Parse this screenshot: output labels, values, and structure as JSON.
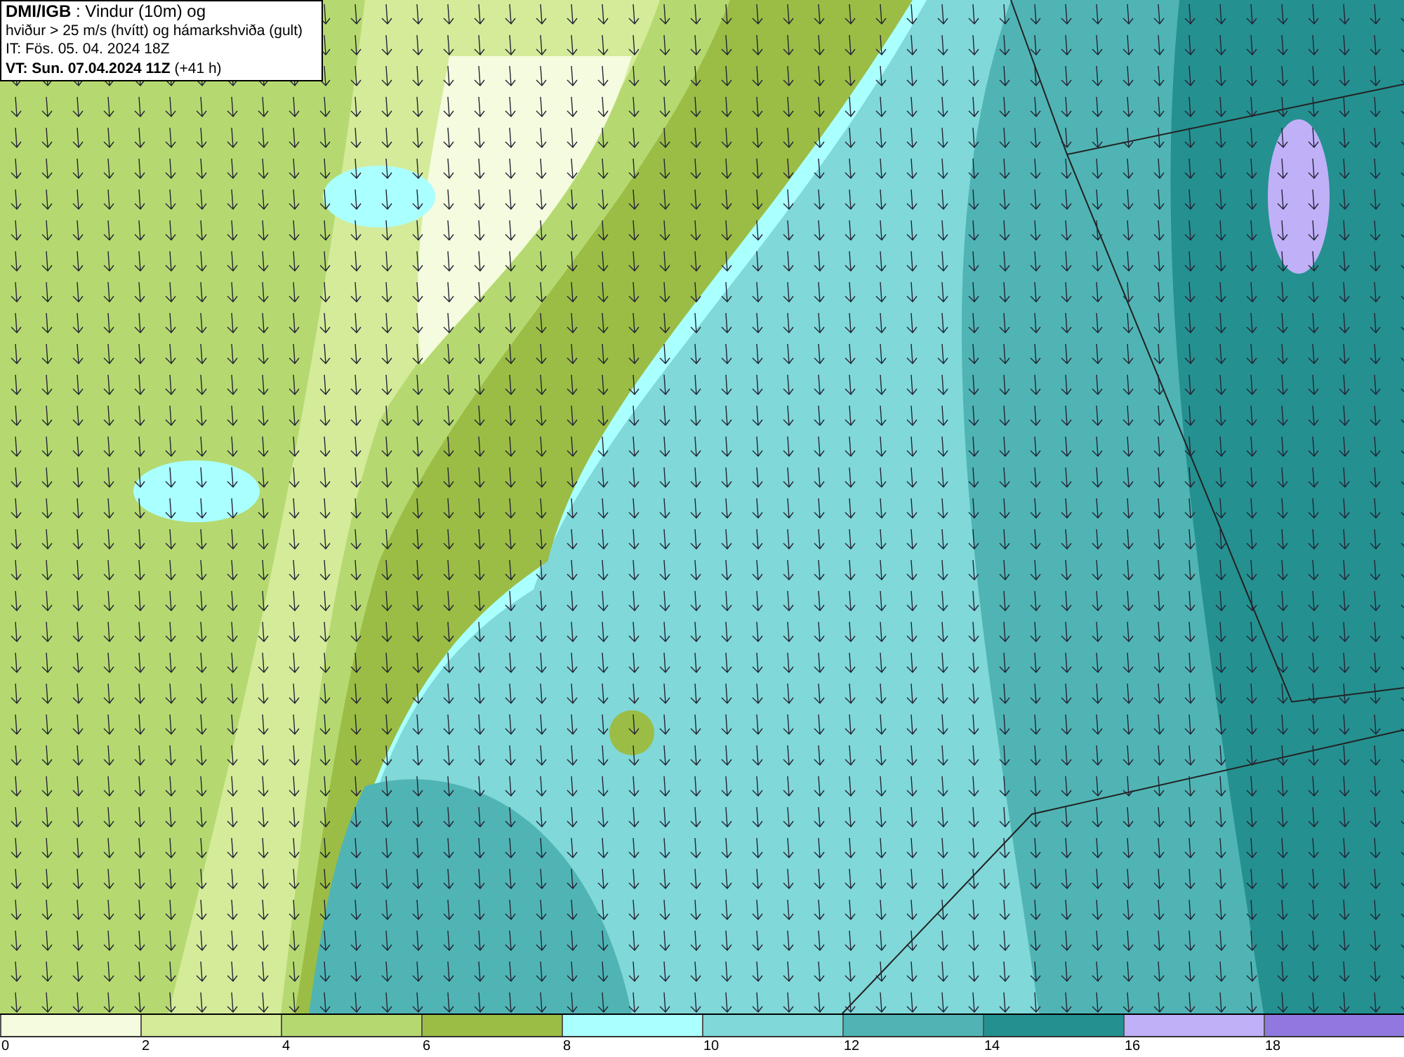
{
  "title_box": {
    "lines": [
      "**DMI/IGB** : Vindur (10m) og",
      "hviður > 25 m/s (hvítt) og hámarkshviða (gult)",
      "IT: Fös. 05. 04. 2024 18Z",
      "**VT: Sun. 07.04.2024 11Z** (+41 h)"
    ]
  },
  "legend": {
    "bins": [
      {
        "color": "#f4fbde",
        "label": "0"
      },
      {
        "color": "#d4eb9a",
        "label": "2"
      },
      {
        "color": "#b5d970",
        "label": "4"
      },
      {
        "color": "#9bbd45",
        "label": "6"
      },
      {
        "color": "#aaffff",
        "label": "8"
      },
      {
        "color": "#80d8d8",
        "label": "10"
      },
      {
        "color": "#50b4b4",
        "label": "12"
      },
      {
        "color": "#259090",
        "label": "14"
      },
      {
        "color": "#c0b0f8",
        "label": "16"
      },
      {
        "color": "#9078e0",
        "label": "18"
      }
    ]
  }
}
